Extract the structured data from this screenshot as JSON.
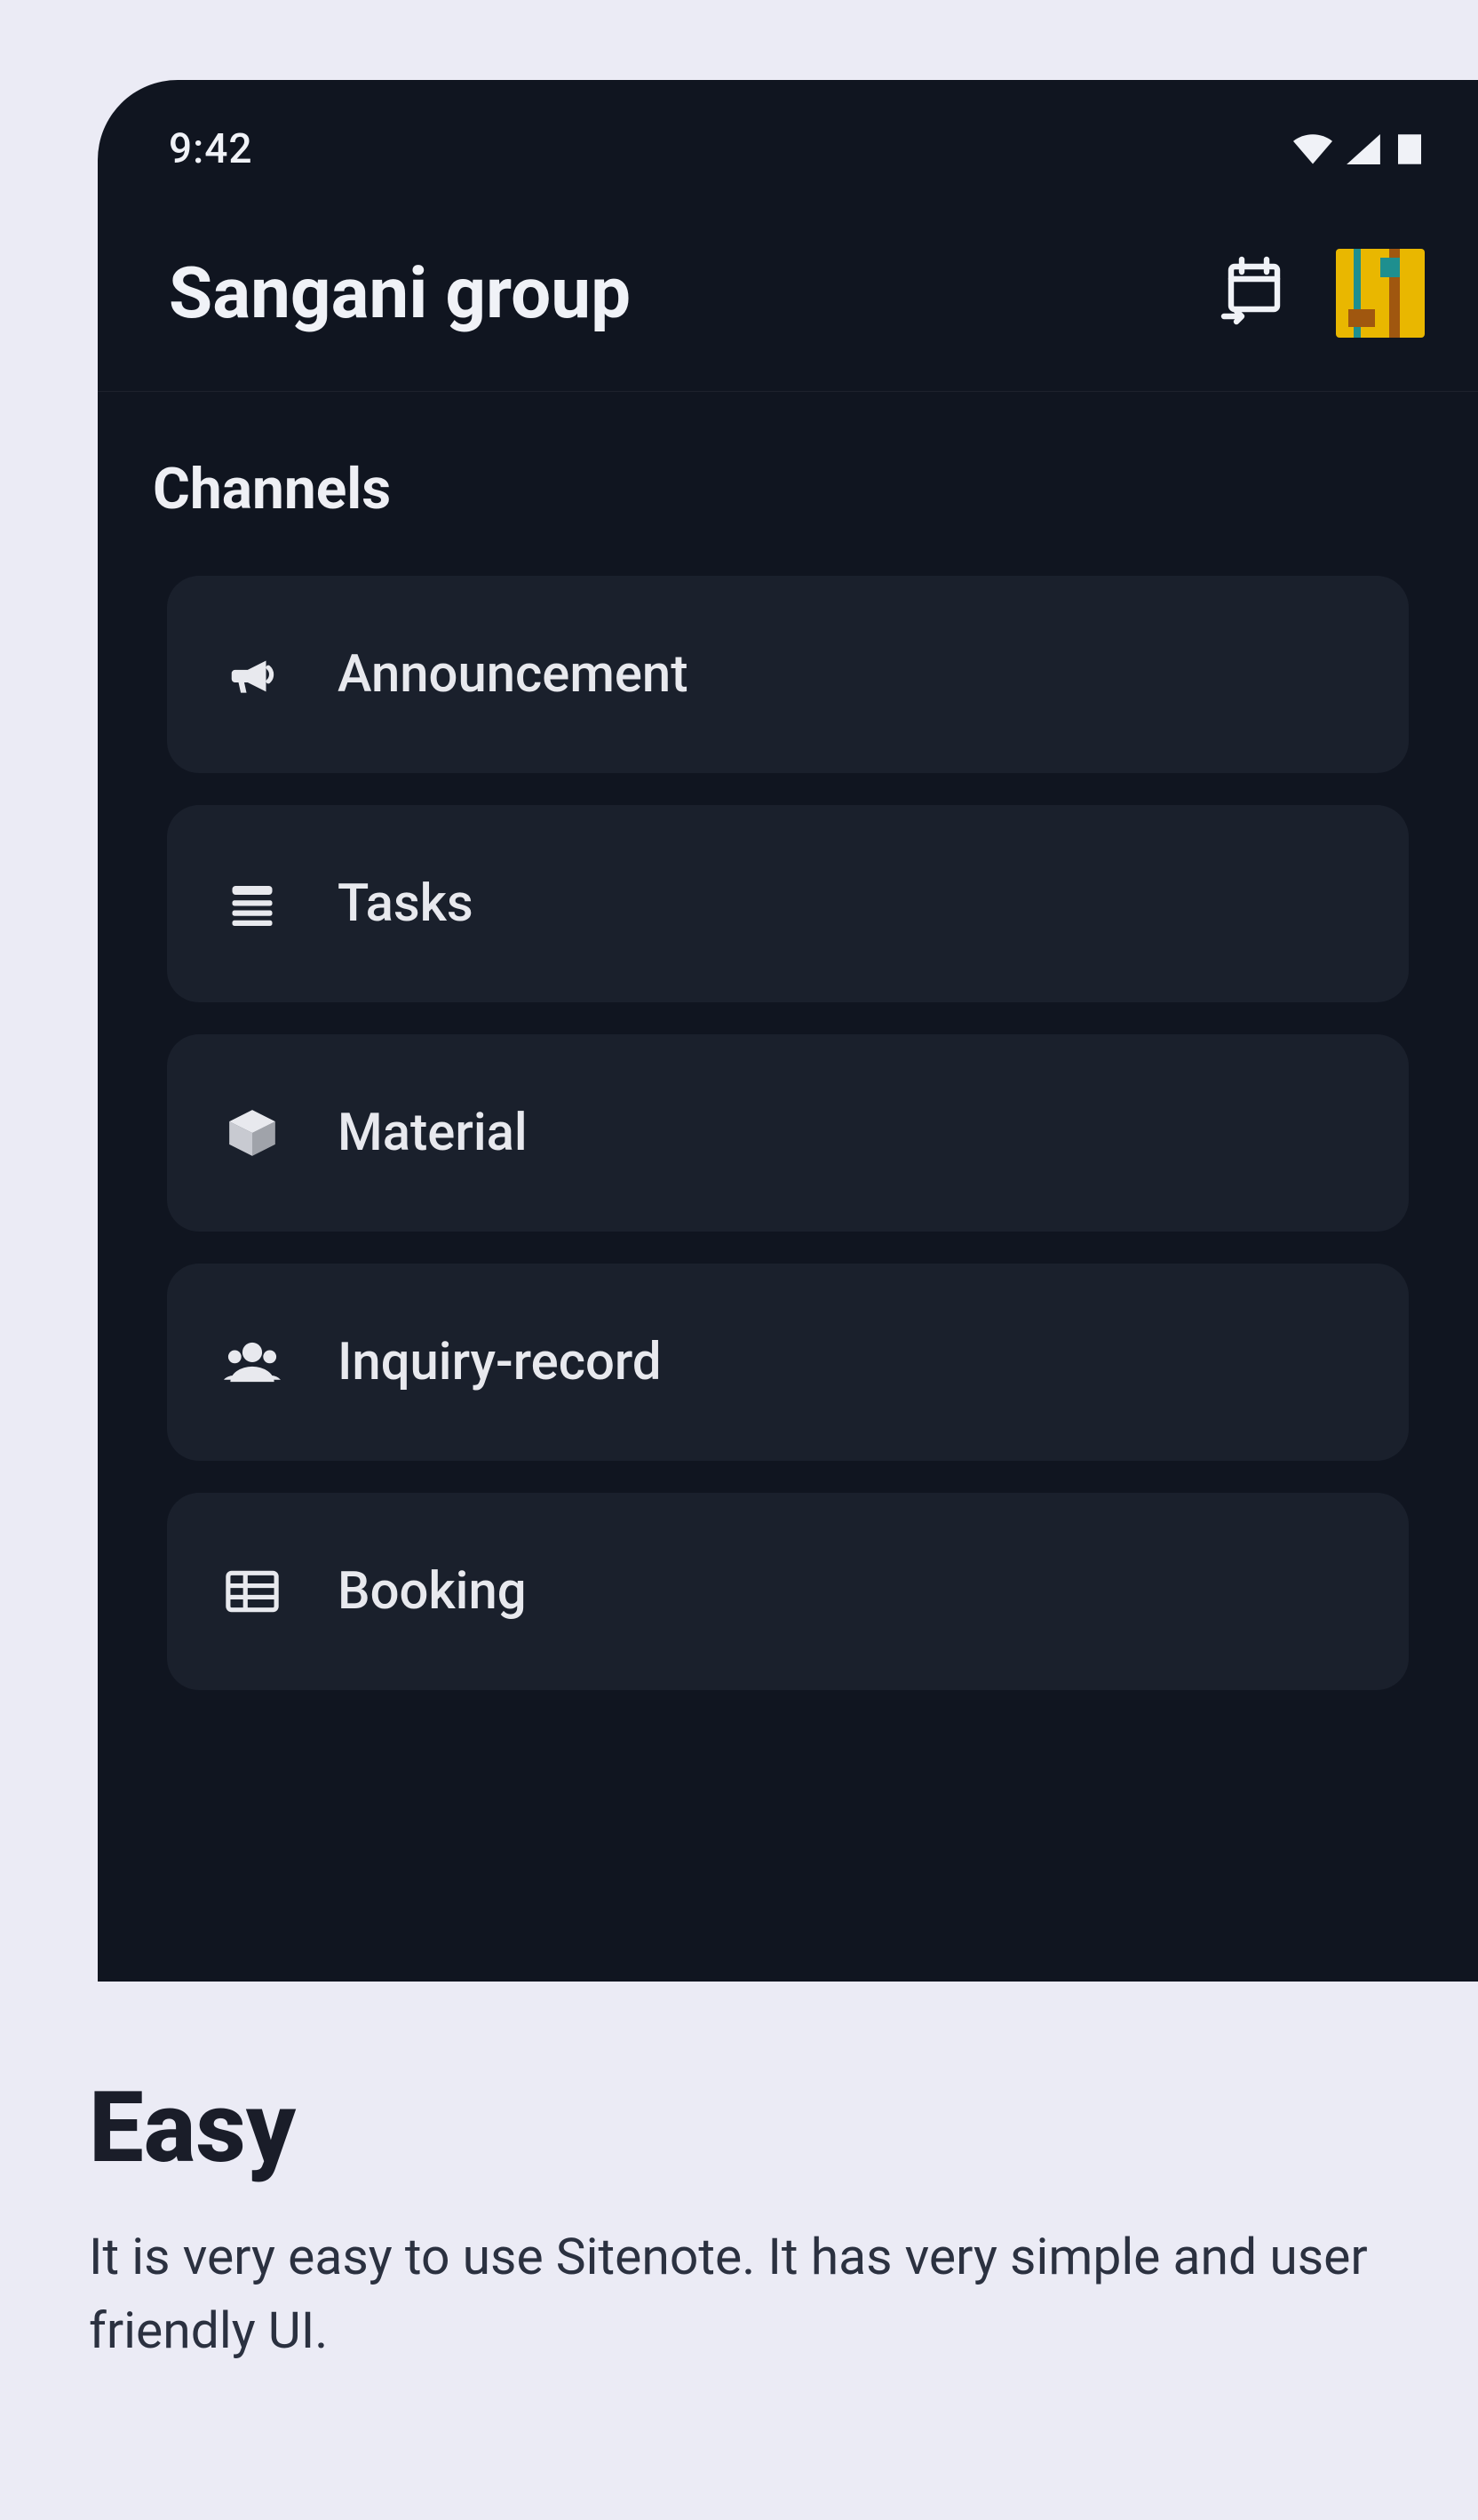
{
  "status": {
    "time": "9:42"
  },
  "header": {
    "title": "Sangani group"
  },
  "section": {
    "title": "Channels"
  },
  "channels": [
    {
      "icon": "bullhorn-icon",
      "label": "Announcement"
    },
    {
      "icon": "list-icon",
      "label": "Tasks"
    },
    {
      "icon": "cube-icon",
      "label": "Material"
    },
    {
      "icon": "users-icon",
      "label": "Inquiry-record"
    },
    {
      "icon": "table-icon",
      "label": "Booking"
    }
  ],
  "caption": {
    "heading": "Easy",
    "body": "It is very easy to use Sitenote. It has very simple and user friendly UI."
  }
}
